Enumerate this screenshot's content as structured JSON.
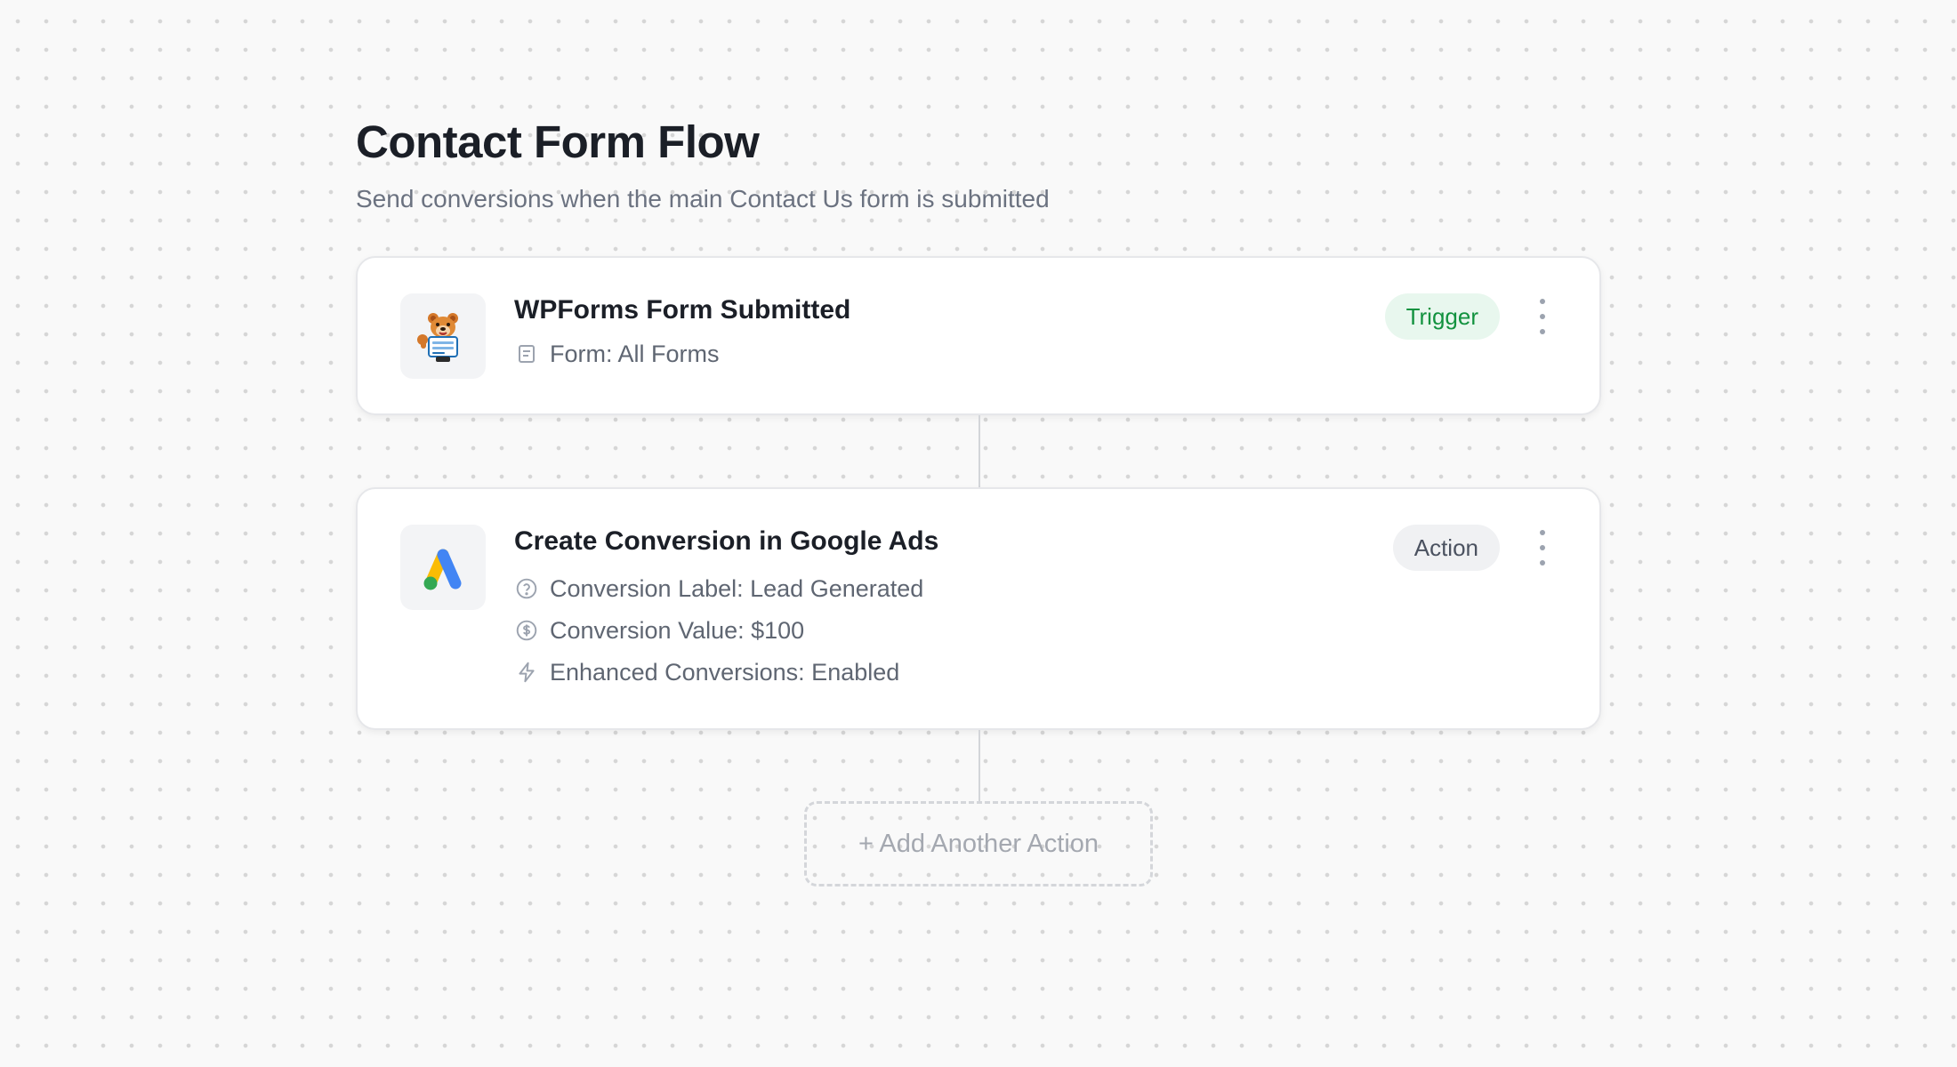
{
  "flow": {
    "title": "Contact Form Flow",
    "subtitle": "Send conversions when the main Contact Us form is submitted"
  },
  "trigger_card": {
    "app_icon": "wpforms-bear-mascot-icon",
    "title": "WPForms Form Submitted",
    "badge": "Trigger",
    "details": [
      {
        "icon": "form-document-icon",
        "text": "Form: All Forms"
      }
    ]
  },
  "action_card": {
    "app_icon": "google-ads-logo-icon",
    "title": "Create Conversion in Google Ads",
    "badge": "Action",
    "details": [
      {
        "icon": "question-circle-icon",
        "text": "Conversion Label: Lead Generated"
      },
      {
        "icon": "dollar-circle-icon",
        "text": "Conversion Value: $100"
      },
      {
        "icon": "lightning-bolt-icon",
        "text": "Enhanced Conversions: Enabled"
      }
    ]
  },
  "add_action": {
    "label": "+ Add Another Action"
  },
  "colors": {
    "background": "#f9f9f9",
    "trigger_badge_bg": "#e8f7ee",
    "trigger_badge_text": "#12923f",
    "action_badge_bg": "#f0f1f3",
    "google_blue": "#4285f4",
    "google_yellow": "#fbbc04",
    "google_green": "#34a853"
  }
}
